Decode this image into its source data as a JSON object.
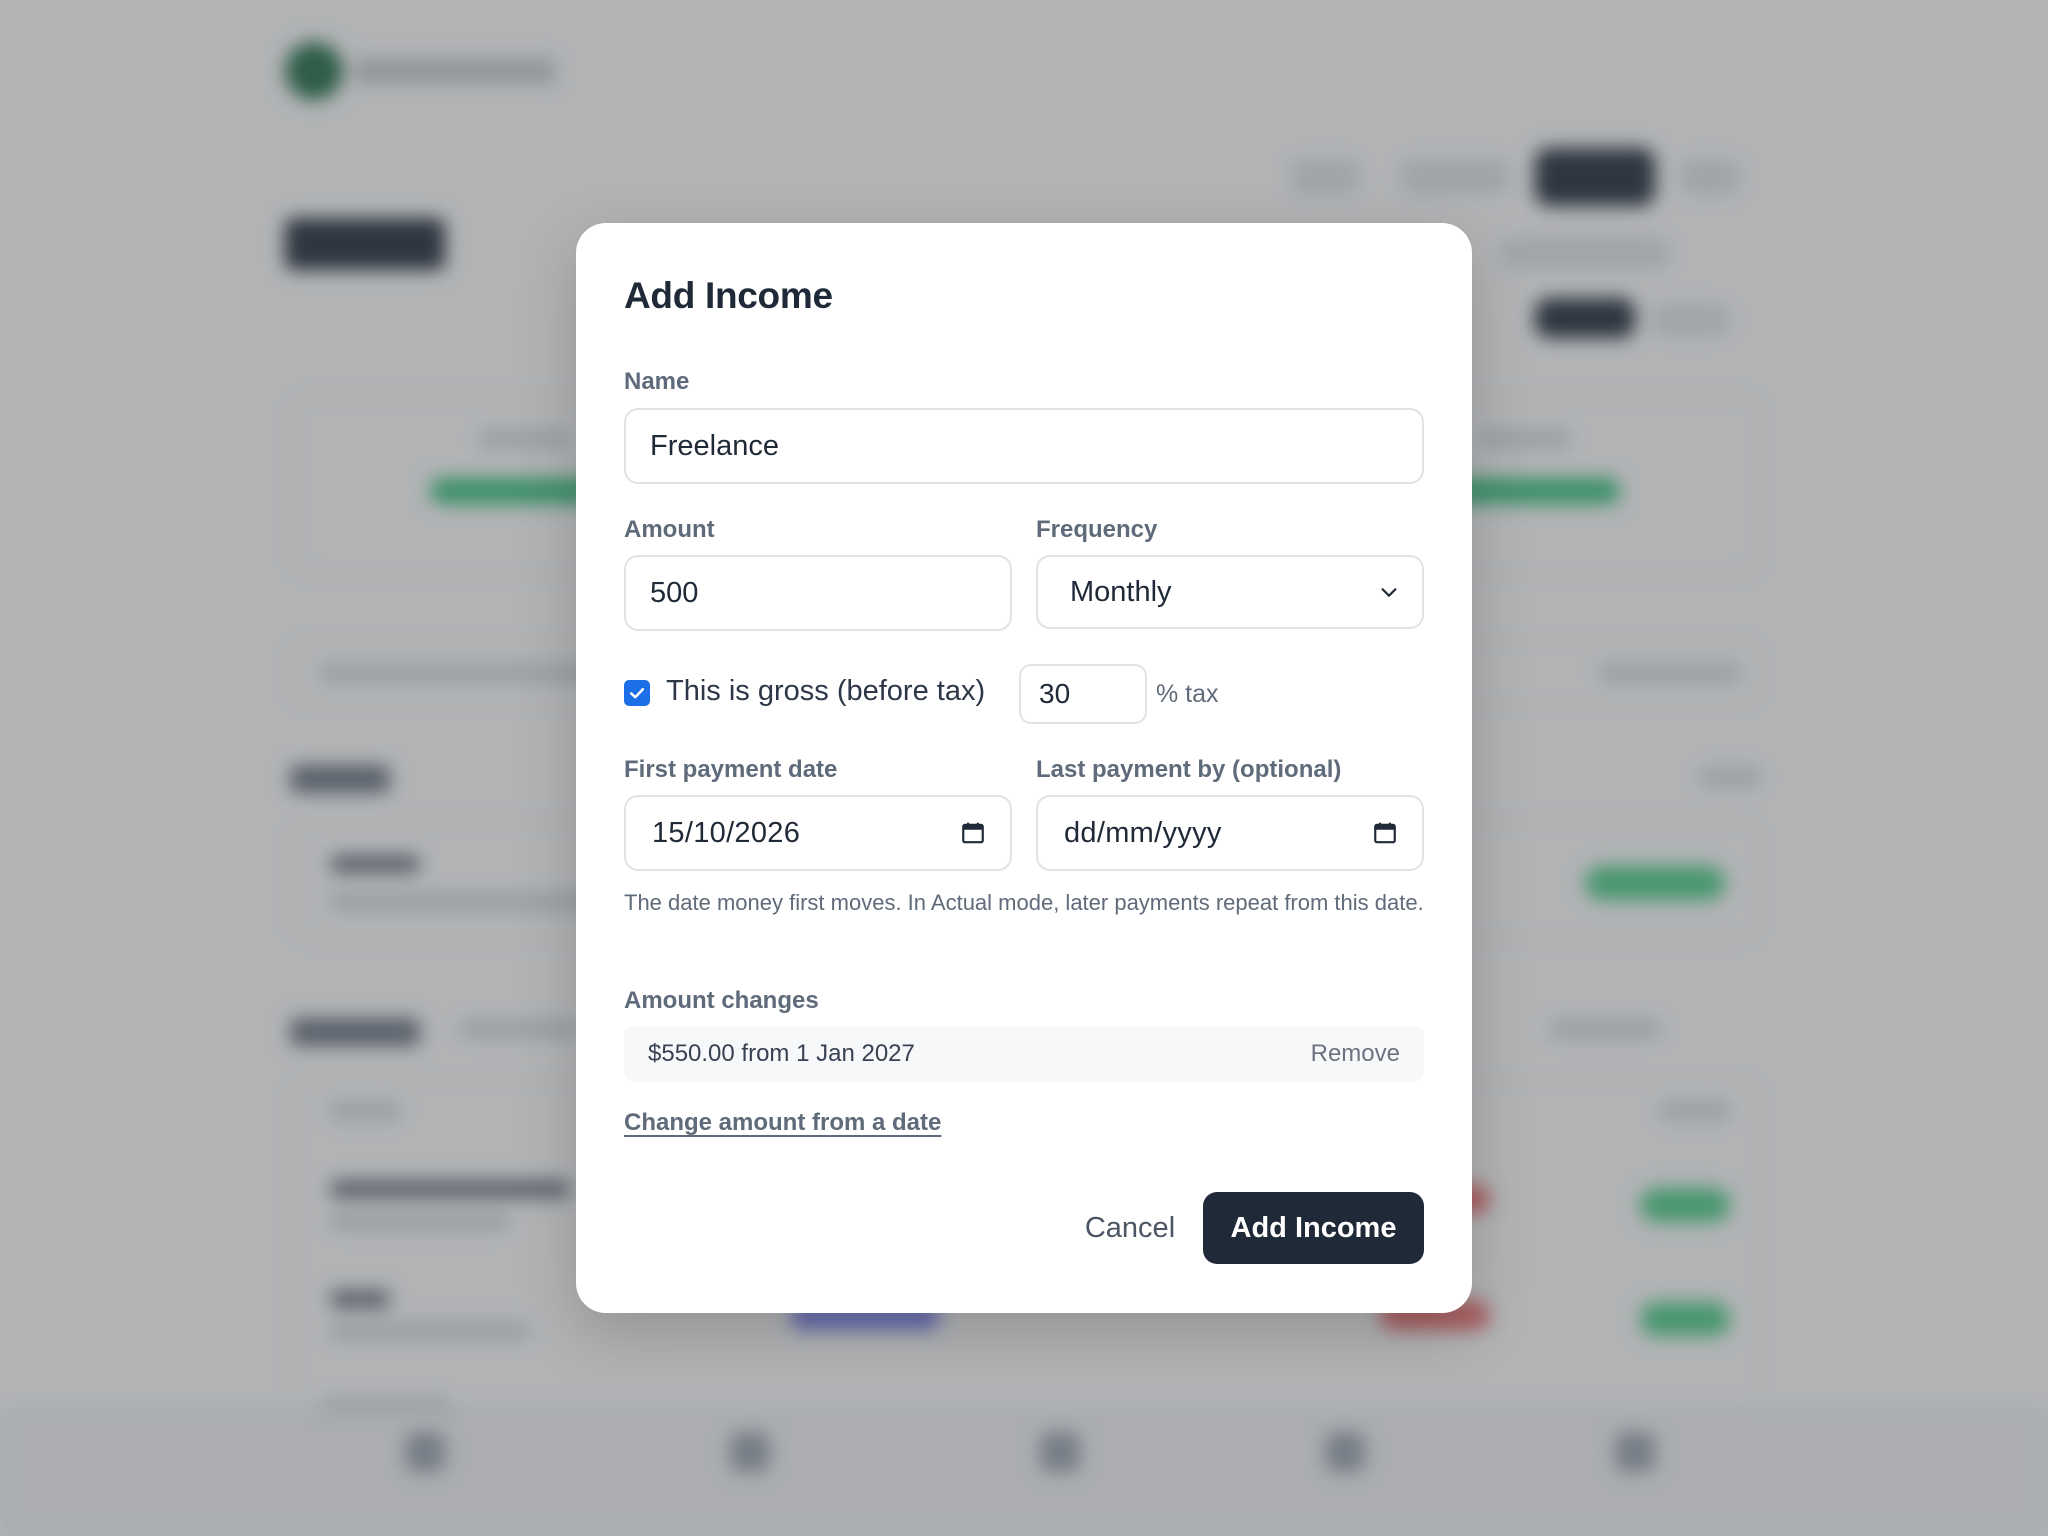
{
  "modal": {
    "title": "Add Income",
    "name": {
      "label": "Name",
      "value": "Freelance"
    },
    "amount": {
      "label": "Amount",
      "value": "500"
    },
    "frequency": {
      "label": "Frequency",
      "value": "Monthly"
    },
    "gross": {
      "label": "This is gross (before tax)",
      "checked": true,
      "tax_value": "30",
      "tax_suffix": "% tax"
    },
    "first_payment": {
      "label": "First payment date",
      "value": "15/10/2026"
    },
    "last_payment": {
      "label": "Last payment by (optional)",
      "placeholder": "dd/mm/yyyy"
    },
    "helper_text": "The date money first moves. In Actual mode, later payments repeat from this date.",
    "amount_changes": {
      "label": "Amount changes",
      "items": [
        {
          "text": "$550.00 from 1 Jan 2027",
          "remove_label": "Remove"
        }
      ],
      "add_link": "Change amount from a date"
    },
    "actions": {
      "cancel": "Cancel",
      "submit": "Add Income"
    }
  },
  "colors": {
    "primary": "#1f2937",
    "checkbox": "#1d6fe8",
    "label": "#5f6b7a",
    "overlay": "#46494e"
  }
}
